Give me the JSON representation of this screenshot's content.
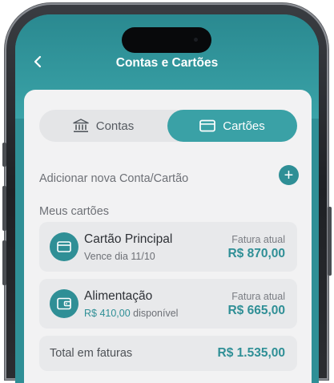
{
  "header": {
    "title": "Contas e Cartões",
    "back_icon": "chevron-left-icon"
  },
  "tabs": [
    {
      "label": "Contas",
      "icon": "bank-icon",
      "selected": false
    },
    {
      "label": "Cartões",
      "icon": "credit-card-icon",
      "selected": true
    }
  ],
  "add_section": {
    "label": "Adicionar nova Conta/Cartão",
    "button_symbol": "+"
  },
  "cards_section": {
    "title": "Meus cartões"
  },
  "cards": [
    {
      "name": "Cartão Principal",
      "subtitle": "Vence dia 11/10",
      "right_label": "Fatura atual",
      "amount": "R$ 870,00",
      "icon": "credit-card-icon"
    },
    {
      "name": "Alimentação",
      "balance": "R$ 410,00",
      "balance_suffix": "disponível",
      "right_label": "Fatura atual",
      "amount": "R$ 665,00",
      "icon": "wallet-icon"
    }
  ],
  "total": {
    "label": "Total em faturas",
    "value": "R$ 1.535,00"
  },
  "colors": {
    "accent": "#2f8f96",
    "accent_light": "#3aa1a6",
    "sheet": "#f2f2f3",
    "row": "#e8e9eb"
  }
}
